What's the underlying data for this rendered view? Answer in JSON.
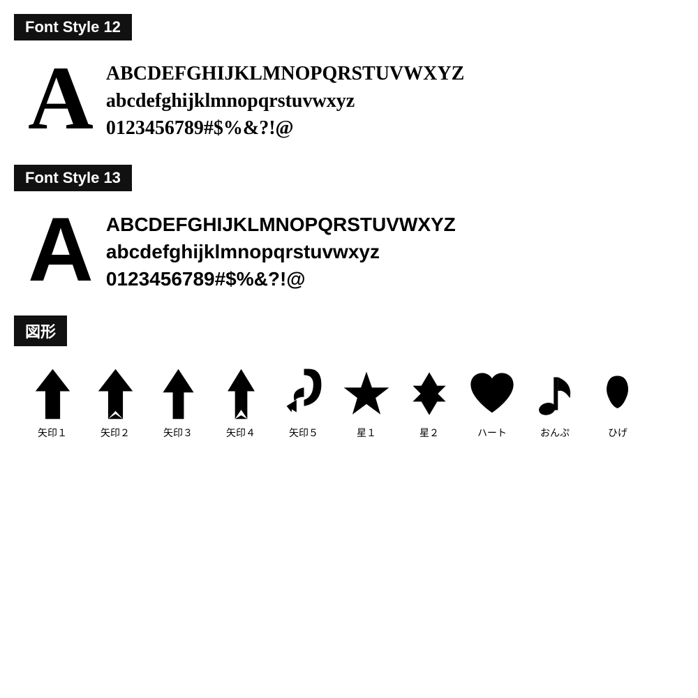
{
  "section1": {
    "label": "Font Style 12",
    "big_letter": "A",
    "lines": [
      "ABCDEFGHIJKLMNOPQRSTUVWXYZ",
      "abcdefghijklmnopqrstuvwxyz",
      "0123456789#$%&?!@"
    ]
  },
  "section2": {
    "label": "Font Style 13",
    "big_letter": "A",
    "lines": [
      "ABCDEFGHIJKLMNOPQRSTUVWXYZ",
      "abcdefghijklmnopqrstuvwxyz",
      "0123456789#$%&?!@"
    ]
  },
  "section3": {
    "label": "図形",
    "shapes": [
      {
        "name": "yajirushi1",
        "label": "矢印１"
      },
      {
        "name": "yajirushi2",
        "label": "矢印２"
      },
      {
        "name": "yajirushi3",
        "label": "矢印３"
      },
      {
        "name": "yajirushi4",
        "label": "矢印４"
      },
      {
        "name": "yajirushi5",
        "label": "矢印５"
      },
      {
        "name": "hoshi1",
        "label": "星１"
      },
      {
        "name": "hoshi2",
        "label": "星２"
      },
      {
        "name": "heart",
        "label": "ハート"
      },
      {
        "name": "onpu",
        "label": "おんぷ"
      },
      {
        "name": "hige",
        "label": "ひげ"
      }
    ]
  }
}
